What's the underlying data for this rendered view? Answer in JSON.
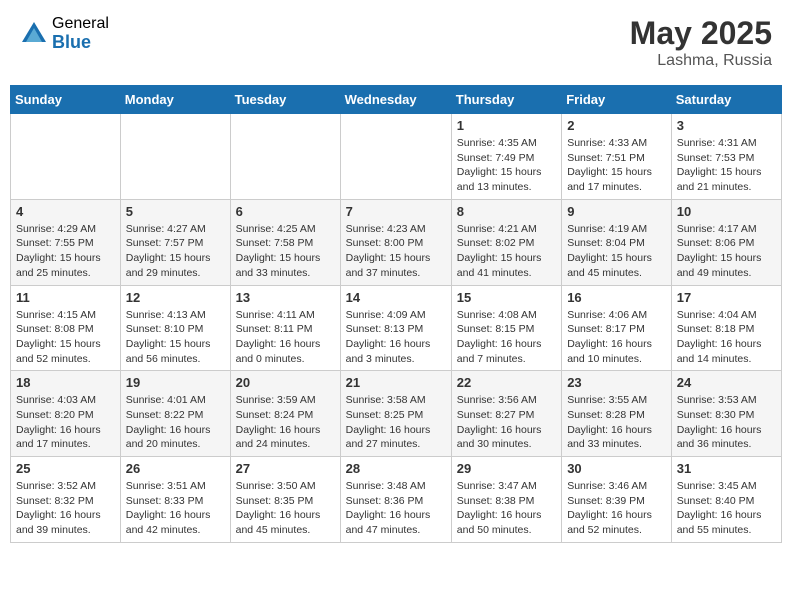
{
  "header": {
    "logo_general": "General",
    "logo_blue": "Blue",
    "month": "May 2025",
    "location": "Lashma, Russia"
  },
  "weekdays": [
    "Sunday",
    "Monday",
    "Tuesday",
    "Wednesday",
    "Thursday",
    "Friday",
    "Saturday"
  ],
  "weeks": [
    [
      {
        "day": "",
        "info": ""
      },
      {
        "day": "",
        "info": ""
      },
      {
        "day": "",
        "info": ""
      },
      {
        "day": "",
        "info": ""
      },
      {
        "day": "1",
        "info": "Sunrise: 4:35 AM\nSunset: 7:49 PM\nDaylight: 15 hours\nand 13 minutes."
      },
      {
        "day": "2",
        "info": "Sunrise: 4:33 AM\nSunset: 7:51 PM\nDaylight: 15 hours\nand 17 minutes."
      },
      {
        "day": "3",
        "info": "Sunrise: 4:31 AM\nSunset: 7:53 PM\nDaylight: 15 hours\nand 21 minutes."
      }
    ],
    [
      {
        "day": "4",
        "info": "Sunrise: 4:29 AM\nSunset: 7:55 PM\nDaylight: 15 hours\nand 25 minutes."
      },
      {
        "day": "5",
        "info": "Sunrise: 4:27 AM\nSunset: 7:57 PM\nDaylight: 15 hours\nand 29 minutes."
      },
      {
        "day": "6",
        "info": "Sunrise: 4:25 AM\nSunset: 7:58 PM\nDaylight: 15 hours\nand 33 minutes."
      },
      {
        "day": "7",
        "info": "Sunrise: 4:23 AM\nSunset: 8:00 PM\nDaylight: 15 hours\nand 37 minutes."
      },
      {
        "day": "8",
        "info": "Sunrise: 4:21 AM\nSunset: 8:02 PM\nDaylight: 15 hours\nand 41 minutes."
      },
      {
        "day": "9",
        "info": "Sunrise: 4:19 AM\nSunset: 8:04 PM\nDaylight: 15 hours\nand 45 minutes."
      },
      {
        "day": "10",
        "info": "Sunrise: 4:17 AM\nSunset: 8:06 PM\nDaylight: 15 hours\nand 49 minutes."
      }
    ],
    [
      {
        "day": "11",
        "info": "Sunrise: 4:15 AM\nSunset: 8:08 PM\nDaylight: 15 hours\nand 52 minutes."
      },
      {
        "day": "12",
        "info": "Sunrise: 4:13 AM\nSunset: 8:10 PM\nDaylight: 15 hours\nand 56 minutes."
      },
      {
        "day": "13",
        "info": "Sunrise: 4:11 AM\nSunset: 8:11 PM\nDaylight: 16 hours\nand 0 minutes."
      },
      {
        "day": "14",
        "info": "Sunrise: 4:09 AM\nSunset: 8:13 PM\nDaylight: 16 hours\nand 3 minutes."
      },
      {
        "day": "15",
        "info": "Sunrise: 4:08 AM\nSunset: 8:15 PM\nDaylight: 16 hours\nand 7 minutes."
      },
      {
        "day": "16",
        "info": "Sunrise: 4:06 AM\nSunset: 8:17 PM\nDaylight: 16 hours\nand 10 minutes."
      },
      {
        "day": "17",
        "info": "Sunrise: 4:04 AM\nSunset: 8:18 PM\nDaylight: 16 hours\nand 14 minutes."
      }
    ],
    [
      {
        "day": "18",
        "info": "Sunrise: 4:03 AM\nSunset: 8:20 PM\nDaylight: 16 hours\nand 17 minutes."
      },
      {
        "day": "19",
        "info": "Sunrise: 4:01 AM\nSunset: 8:22 PM\nDaylight: 16 hours\nand 20 minutes."
      },
      {
        "day": "20",
        "info": "Sunrise: 3:59 AM\nSunset: 8:24 PM\nDaylight: 16 hours\nand 24 minutes."
      },
      {
        "day": "21",
        "info": "Sunrise: 3:58 AM\nSunset: 8:25 PM\nDaylight: 16 hours\nand 27 minutes."
      },
      {
        "day": "22",
        "info": "Sunrise: 3:56 AM\nSunset: 8:27 PM\nDaylight: 16 hours\nand 30 minutes."
      },
      {
        "day": "23",
        "info": "Sunrise: 3:55 AM\nSunset: 8:28 PM\nDaylight: 16 hours\nand 33 minutes."
      },
      {
        "day": "24",
        "info": "Sunrise: 3:53 AM\nSunset: 8:30 PM\nDaylight: 16 hours\nand 36 minutes."
      }
    ],
    [
      {
        "day": "25",
        "info": "Sunrise: 3:52 AM\nSunset: 8:32 PM\nDaylight: 16 hours\nand 39 minutes."
      },
      {
        "day": "26",
        "info": "Sunrise: 3:51 AM\nSunset: 8:33 PM\nDaylight: 16 hours\nand 42 minutes."
      },
      {
        "day": "27",
        "info": "Sunrise: 3:50 AM\nSunset: 8:35 PM\nDaylight: 16 hours\nand 45 minutes."
      },
      {
        "day": "28",
        "info": "Sunrise: 3:48 AM\nSunset: 8:36 PM\nDaylight: 16 hours\nand 47 minutes."
      },
      {
        "day": "29",
        "info": "Sunrise: 3:47 AM\nSunset: 8:38 PM\nDaylight: 16 hours\nand 50 minutes."
      },
      {
        "day": "30",
        "info": "Sunrise: 3:46 AM\nSunset: 8:39 PM\nDaylight: 16 hours\nand 52 minutes."
      },
      {
        "day": "31",
        "info": "Sunrise: 3:45 AM\nSunset: 8:40 PM\nDaylight: 16 hours\nand 55 minutes."
      }
    ]
  ]
}
